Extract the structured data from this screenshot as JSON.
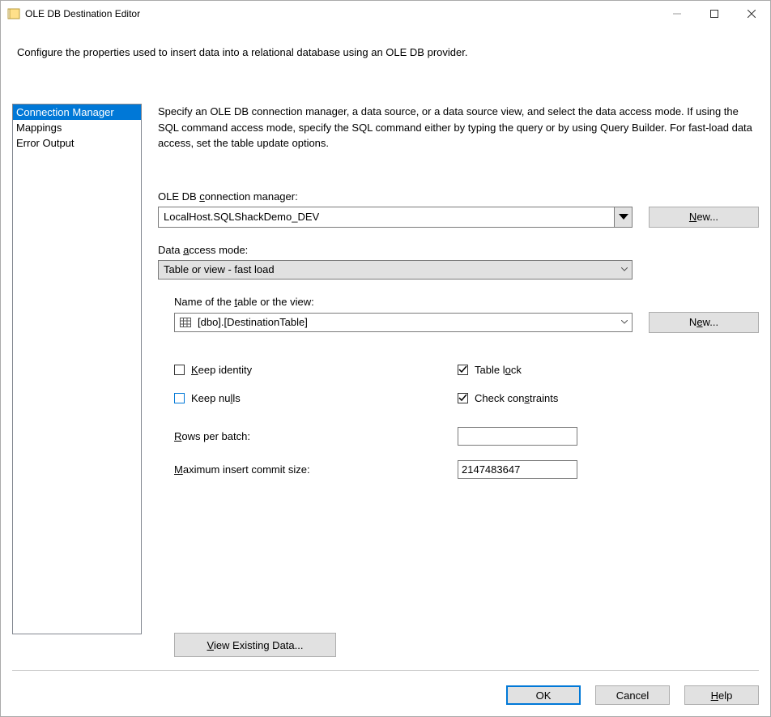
{
  "window": {
    "title": "OLE DB Destination Editor"
  },
  "description": "Configure the properties used to insert data into a relational database using an OLE DB provider.",
  "nav": {
    "items": [
      {
        "label": "Connection Manager",
        "selected": true
      },
      {
        "label": "Mappings",
        "selected": false
      },
      {
        "label": "Error Output",
        "selected": false
      }
    ]
  },
  "form": {
    "instructions": "Specify an OLE DB connection manager, a data source, or a data source view, and select the data access mode. If using the SQL command access mode, specify the SQL command either by typing the query or by using Query Builder. For fast-load data access, set the table update options.",
    "connMgrLabel": "OLE DB connection manager:",
    "connMgrValue": "LocalHost.SQLShackDemo_DEV",
    "newBtn": "New...",
    "accessModeLabel": "Data access mode:",
    "accessModeValue": "Table or view - fast load",
    "tableLabel": "Name of the table or the view:",
    "tableValue": "[dbo].[DestinationTable]",
    "newBtn2": "New...",
    "check": {
      "keepIdentity": "Keep identity",
      "keepNulls": "Keep nulls",
      "tableLock": "Table lock",
      "checkConstraints": "Check constraints"
    },
    "rowsPerBatchLabel": "Rows per batch:",
    "rowsPerBatchValue": "",
    "maxCommitLabel": "Maximum insert commit size:",
    "maxCommitValue": "2147483647",
    "viewExisting": "View Existing Data..."
  },
  "footer": {
    "ok": "OK",
    "cancel": "Cancel",
    "help": "Help"
  }
}
